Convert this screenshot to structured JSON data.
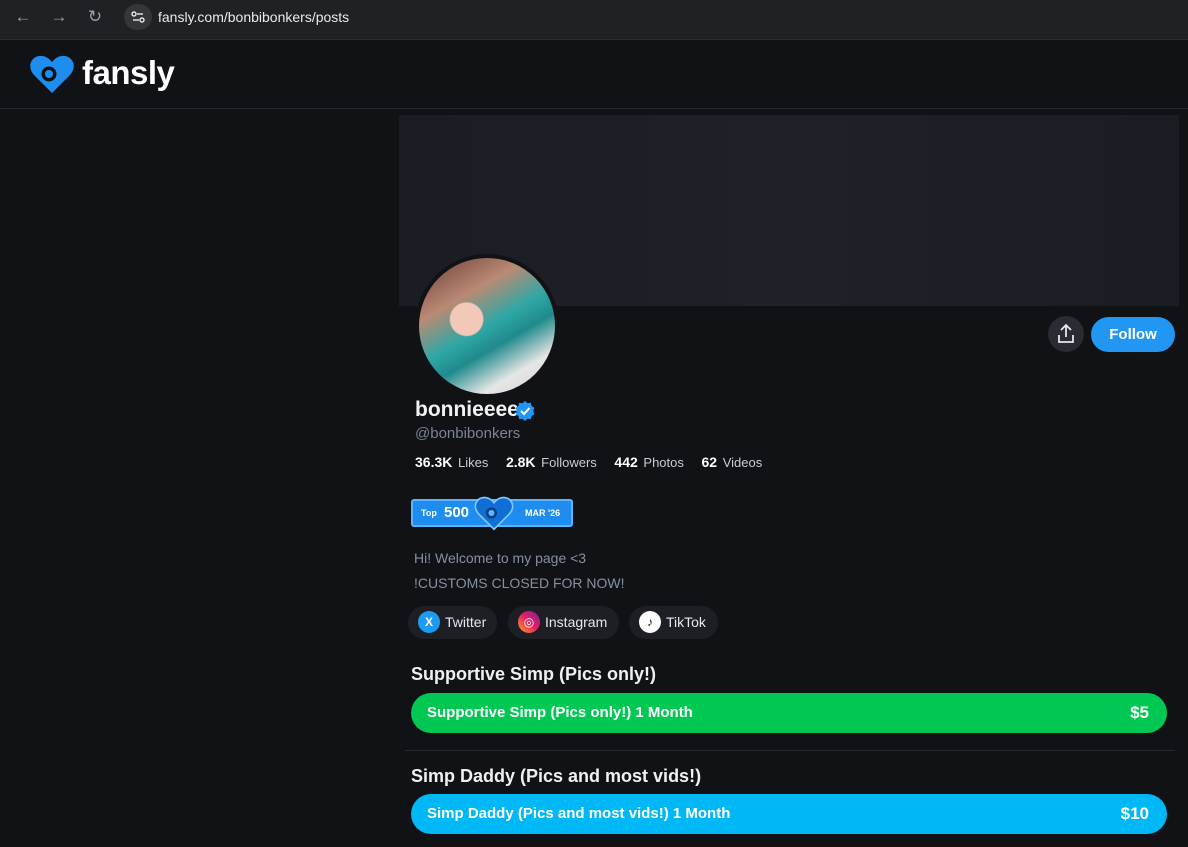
{
  "browser": {
    "url": "fansly.com/bonbibonkers/posts",
    "back_icon": "←",
    "forward_icon": "→",
    "reload_icon": "↻"
  },
  "site": {
    "logo_text": "fansly",
    "brand_color": "#2196f3"
  },
  "profile": {
    "display_name": "bonnieeee",
    "handle": "@bonbibonkers",
    "follow_label": "Follow",
    "stats": [
      {
        "value": "36.3K",
        "label": "Likes"
      },
      {
        "value": "2.8K",
        "label": "Followers"
      },
      {
        "value": "442",
        "label": "Photos"
      },
      {
        "value": "62",
        "label": "Videos"
      }
    ],
    "badge": {
      "top": "Top",
      "rank": "500",
      "month": "MAR '26"
    },
    "bio": [
      "Hi! Welcome to my page <3",
      "!CUSTOMS CLOSED FOR NOW!"
    ],
    "socials": [
      {
        "label": "Twitter",
        "icon": "x-icon",
        "glyph": "X",
        "color": "#1d9bf0"
      },
      {
        "label": "Instagram",
        "icon": "instagram-icon",
        "glyph": "◎",
        "color": "#d6249f"
      },
      {
        "label": "TikTok",
        "icon": "tiktok-icon",
        "glyph": "♪",
        "color": "#ffffff"
      }
    ]
  },
  "tiers": [
    {
      "title": "Supportive Simp (Pics only!)",
      "button_label": "Supportive Simp (Pics only!) 1 Month",
      "price": "$5",
      "color": "#00c853"
    },
    {
      "title": "Simp Daddy (Pics and most vids!)",
      "button_label": "Simp Daddy (Pics and most vids!) 1 Month",
      "price": "$10",
      "color": "#00b8f5"
    }
  ]
}
